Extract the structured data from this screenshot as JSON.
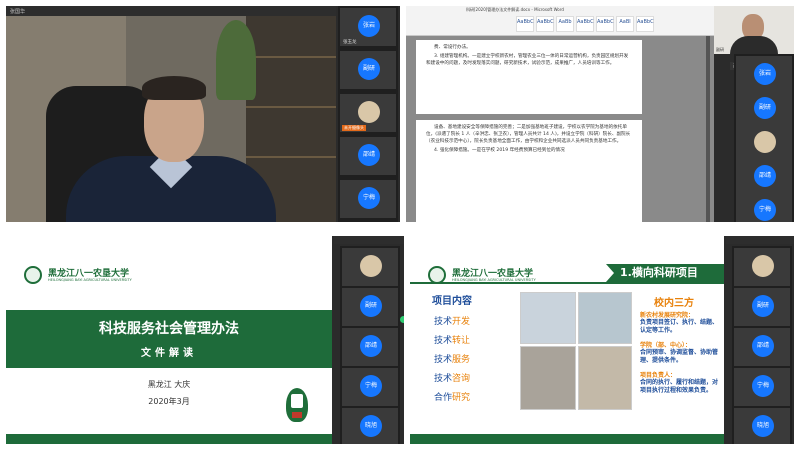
{
  "topleft": {
    "window_title": "张国华",
    "participants": [
      {
        "label": "张岩",
        "name": "张玉龙",
        "photo": false
      },
      {
        "label": "副研",
        "name": "",
        "photo": false
      },
      {
        "label": "",
        "name": "",
        "photo": true,
        "badge": "未开摄像头"
      },
      {
        "label": "邵靖",
        "name": "",
        "photo": false
      },
      {
        "label": "宁梅",
        "name": "",
        "photo": false
      }
    ]
  },
  "topright": {
    "word_title": "科研[2020]管理办法文件解读.docx - Microsoft Word",
    "ribbon_styles": [
      "AaBbC",
      "AaBbC",
      "AaBb",
      "AaBbC",
      "AaBbC",
      "AaBl",
      "AaBbC"
    ],
    "selfcam_name": "副研",
    "tooltip": "正在讲话：副研",
    "page1": [
      "费、常设行办法。",
      "3. 组建管理机构。一是建立学校新农村，管理农业三位一体的日常运营机构，负责园区规划开发和建设中的问题，及时发现落实问题，研究新技术，试验示范，成果推广，人员培训等工作。"
    ],
    "page2": [
      "设备、基地建设安全等保障措施的完善；二是加强基地班子建设，学校以农学院为基地的依托单位，(派遣了院长 1 人（辛洪忠、张卫农），管理人员共计 14 人)，并设立学院（科研）院长、副院长（农业科技示范中心），院长负责基地全面工作，由学校和企业共同选派人员共同负责基地工作。",
      "4. 强化保障措施。一是在学校 2019 年经费预算已经到位的情况"
    ],
    "participants": [
      {
        "label": "张岩",
        "name": "",
        "photo": false
      },
      {
        "label": "副研",
        "name": "",
        "photo": false
      },
      {
        "label": "",
        "name": "",
        "photo": true
      },
      {
        "label": "邵靖",
        "name": "",
        "photo": false
      },
      {
        "label": "宁梅",
        "name": "",
        "photo": false
      }
    ]
  },
  "bottomleft": {
    "university_cn": "黑龙江八一农垦大学",
    "university_en": "HEILONGJIANG BAYI AGRICULTURAL UNIVERSITY",
    "title": "科技服务社会管理办法",
    "subtitle": "文件解读",
    "place": "黑龙江 大庆",
    "date": "2020年3月",
    "participants": [
      {
        "label": "",
        "name": "",
        "photo": true
      },
      {
        "label": "副研",
        "name": "",
        "photo": false
      },
      {
        "label": "邵靖",
        "name": "",
        "photo": false
      },
      {
        "label": "宁梅",
        "name": "",
        "photo": false
      },
      {
        "label": "晓旭",
        "name": "",
        "photo": false
      }
    ]
  },
  "bottomright": {
    "university_cn": "黑龙江八一农垦大学",
    "university_en": "HEILONGJIANG BAYI AGRICULTURAL UNIVERSITY",
    "section_title": "1.横向科研项目",
    "left_heading": "项目内容",
    "items": [
      {
        "a": "技术",
        "b": "开发"
      },
      {
        "a": "技术",
        "b": "转让"
      },
      {
        "a": "技术",
        "b": "服务"
      },
      {
        "a": "技术",
        "b": "咨询"
      },
      {
        "a": "合作",
        "b": "研究"
      }
    ],
    "right_heading": "校内三方",
    "right_blocks": [
      {
        "title": "新农村发展研究院：",
        "desc": "负责项目签订、执行、结题、认定等工作。"
      },
      {
        "title": "学院（部、中心）：",
        "desc": "合同预审、协调监督、协助管理、提供条件。"
      },
      {
        "title": "项目负责人：",
        "desc": "合同的执行、履行和结题，对项目执行过程和效果负责。"
      }
    ],
    "participants": [
      {
        "label": "",
        "name": "",
        "photo": true
      },
      {
        "label": "副研",
        "name": "",
        "photo": false
      },
      {
        "label": "邵靖",
        "name": "",
        "photo": false
      },
      {
        "label": "宁梅",
        "name": "",
        "photo": false
      },
      {
        "label": "晓旭",
        "name": "",
        "photo": false
      }
    ]
  }
}
